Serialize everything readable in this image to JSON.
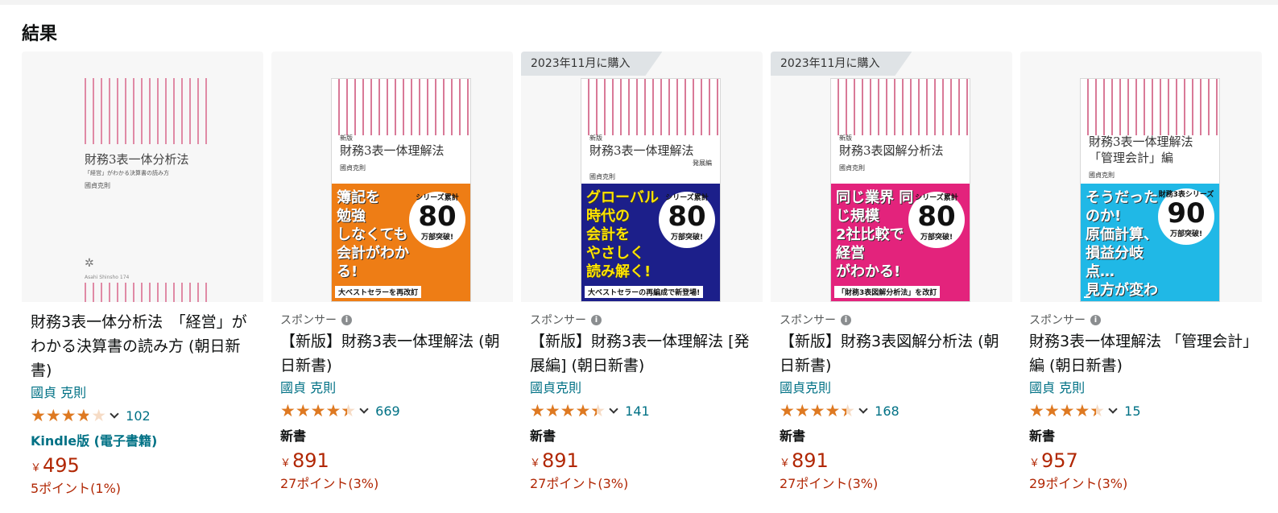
{
  "heading": "結果",
  "sponsor_label": "スポンサー",
  "products": [
    {
      "purchased": "",
      "sponsored": false,
      "title": "財務3表一体分析法　「経営」がわかる決算書の読み方 (朝日新書)",
      "author": "國貞 克則",
      "rating": 3.8,
      "review_count": "102",
      "format": "Kindle版 (電子書籍)",
      "price_symbol": "￥",
      "price": "495",
      "points": "5ポイント(1%)",
      "cover": {
        "title": "財務3表一体分析法",
        "subtitle": "「経営」がわかる決算書の読み方",
        "author": "國貞克則",
        "mark": "✲",
        "foot": "Asahi Shinsho 174"
      }
    },
    {
      "purchased": "",
      "sponsored": true,
      "title": "【新版】財務3表一体理解法 (朝日新書)",
      "author": "國貞 克則",
      "rating": 4.4,
      "review_count": "669",
      "format": "新書",
      "price_symbol": "￥",
      "price": "891",
      "points": "27ポイント(3%)",
      "cover": {
        "small": "新版",
        "title": "財務3表一体理解法",
        "subtitle": "",
        "author": "國貞克則",
        "band": "簿記を\n勉強\nしなくても\n会計がわかる!",
        "badge_top": "シリーズ累計",
        "badge_num": "80",
        "badge_bottom": "万部突破!",
        "foot": "大ベストセラーを再改訂"
      }
    },
    {
      "purchased": "2023年11月に購入",
      "sponsored": true,
      "title": "【新版】財務3表一体理解法 [発展編] (朝日新書)",
      "author": "國貞克則",
      "rating": 4.4,
      "review_count": "141",
      "format": "新書",
      "price_symbol": "￥",
      "price": "891",
      "points": "27ポイント(3%)",
      "cover": {
        "small": "新版",
        "title": "財務3表一体理解法",
        "subtitle": "発展編",
        "author": "國貞克則",
        "band": "グローバル時代の\n会計を\nやさしく\n読み解く!",
        "badge_top": "シリーズ累計",
        "badge_num": "80",
        "badge_bottom": "万部突破!",
        "foot": "大ベストセラーの再編成で新登場!"
      }
    },
    {
      "purchased": "2023年11月に購入",
      "sponsored": true,
      "title": "【新版】財務3表図解分析法 (朝日新書)",
      "author": "國貞克則",
      "rating": 4.4,
      "review_count": "168",
      "format": "新書",
      "price_symbol": "￥",
      "price": "891",
      "points": "27ポイント(3%)",
      "cover": {
        "small": "新版",
        "title": "財務3表図解分析法",
        "subtitle": "",
        "author": "國貞克則",
        "band": "同じ業界 同じ規模\n2社比較で\n経営\nがわかる!",
        "badge_top": "シリーズ累計",
        "badge_num": "80",
        "badge_bottom": "万部突破!",
        "foot": "「財務3表図解分析法」を改訂"
      }
    },
    {
      "purchased": "",
      "sponsored": true,
      "title": "財務3表一体理解法 「管理会計」編 (朝日新書)",
      "author": "國貞 克則",
      "rating": 4.4,
      "review_count": "15",
      "format": "新書",
      "price_symbol": "￥",
      "price": "957",
      "points": "29ポイント(3%)",
      "cover": {
        "small": "",
        "title": "財務3表一体理解法\n「管理会計」編",
        "subtitle": "",
        "author": "國貞克則",
        "band": "そうだったのか!\n原価計算、\n損益分岐点…\n見方が変わる!",
        "badge_top": "財務3表シリーズ",
        "badge_num": "90",
        "badge_bottom": "万部突破!",
        "foot": ""
      }
    }
  ],
  "colors": {
    "accent_link": "#007185",
    "price_red": "#b12704",
    "star_orange": "#de7921"
  }
}
